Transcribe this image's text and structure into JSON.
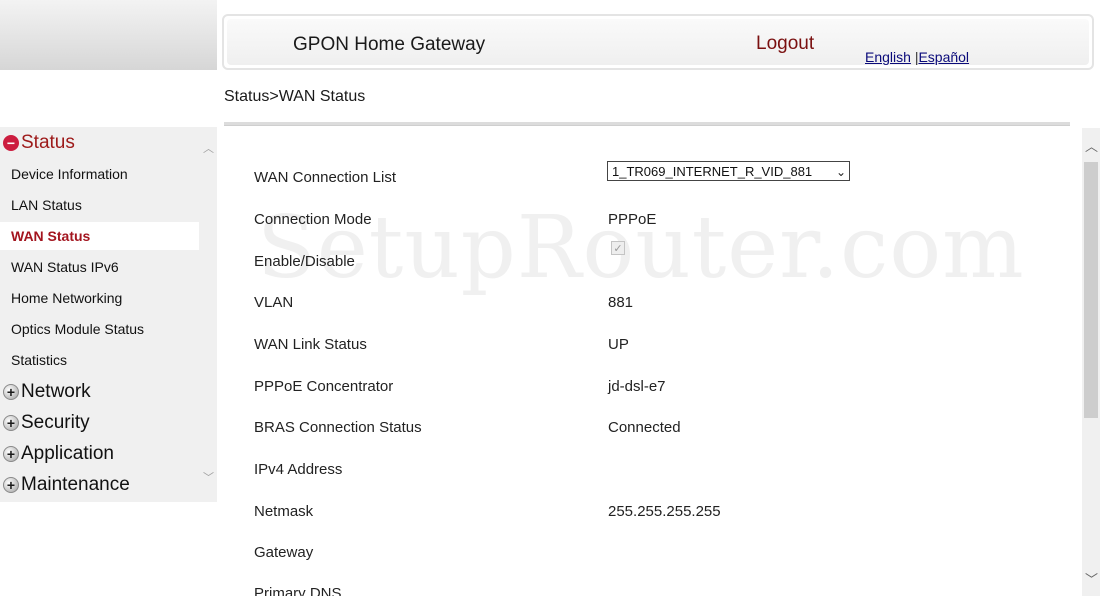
{
  "header": {
    "title": "GPON Home Gateway",
    "logout": "Logout",
    "lang_english": "English",
    "lang_sep": "|",
    "lang_spanish": "Español"
  },
  "breadcrumb": "Status>WAN Status",
  "sidebar": {
    "groups": [
      {
        "label": "Status",
        "expanded": true
      },
      {
        "label": "Network",
        "expanded": false
      },
      {
        "label": "Security",
        "expanded": false
      },
      {
        "label": "Application",
        "expanded": false
      },
      {
        "label": "Maintenance",
        "expanded": false
      }
    ],
    "items": [
      {
        "label": "Device Information"
      },
      {
        "label": "LAN Status"
      },
      {
        "label": "WAN Status",
        "active": true
      },
      {
        "label": "WAN Status IPv6"
      },
      {
        "label": "Home Networking"
      },
      {
        "label": "Optics Module Status"
      },
      {
        "label": "Statistics"
      }
    ]
  },
  "watermark": "SetupRouter.com",
  "wan": {
    "connection_list_label": "WAN Connection List",
    "connection_list_value": "1_TR069_INTERNET_R_VID_881",
    "fields": [
      {
        "label": "Connection Mode",
        "value": "PPPoE"
      },
      {
        "label": "Enable/Disable",
        "value": ""
      },
      {
        "label": "VLAN",
        "value": "881"
      },
      {
        "label": "WAN Link Status",
        "value": "UP"
      },
      {
        "label": "PPPoE Concentrator",
        "value": "jd-dsl-e7"
      },
      {
        "label": "BRAS Connection Status",
        "value": "Connected"
      },
      {
        "label": "IPv4 Address",
        "value": ""
      },
      {
        "label": "Netmask",
        "value": "255.255.255.255"
      },
      {
        "label": "Gateway",
        "value": ""
      },
      {
        "label": "Primary DNS",
        "value": ""
      }
    ],
    "enable_checked": true
  },
  "colors": {
    "accent": "#a3151f",
    "logout": "#7a1010"
  }
}
